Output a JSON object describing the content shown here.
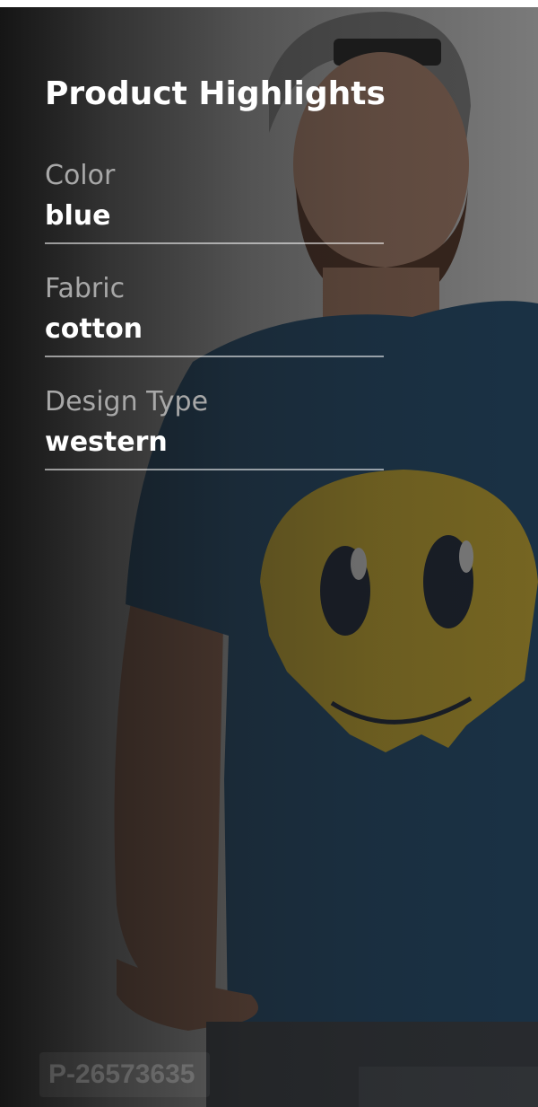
{
  "highlights": {
    "title": "Product Highlights",
    "attributes": [
      {
        "label": "Color",
        "value": "blue"
      },
      {
        "label": "Fabric",
        "value": "cotton"
      },
      {
        "label": "Design Type",
        "value": "western"
      }
    ]
  },
  "product_id_watermark": "P-26573635",
  "colors": {
    "shirt": "#1c4f7a",
    "emoji": "#e6c22c"
  }
}
